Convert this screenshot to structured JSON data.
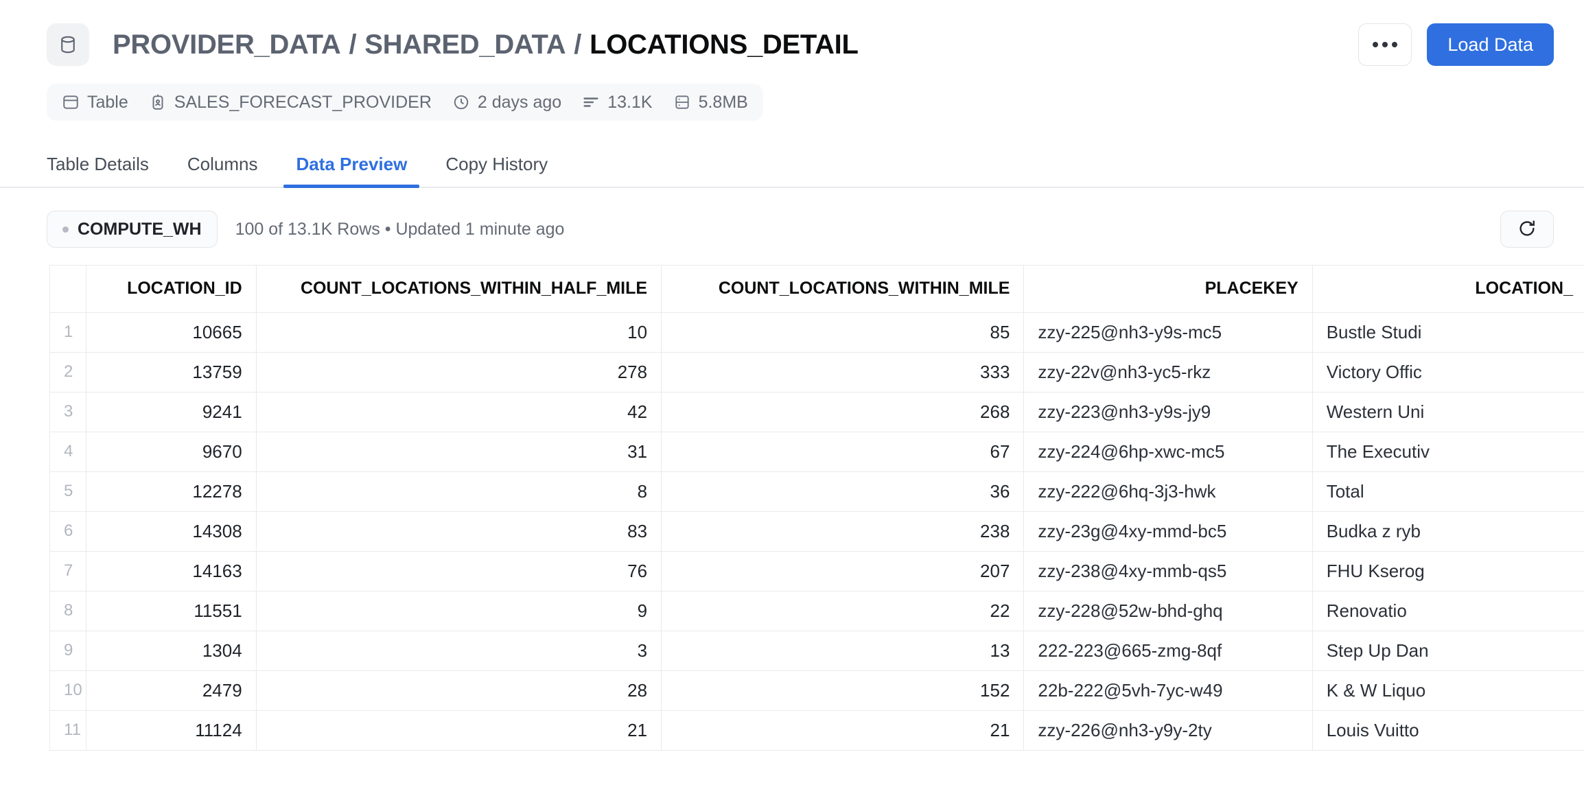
{
  "header": {
    "db_icon": "database-icon",
    "breadcrumb": {
      "parts": [
        "PROVIDER_DATA",
        "SHARED_DATA"
      ],
      "separator": "/",
      "current": "LOCATIONS_DETAIL"
    },
    "more_label": "",
    "load_data_label": "Load Data",
    "accent_color": "#2f6fe0"
  },
  "meta": [
    {
      "icon": "table-icon",
      "label": "Table"
    },
    {
      "icon": "provider-icon",
      "label": "SALES_FORECAST_PROVIDER"
    },
    {
      "icon": "clock-icon",
      "label": "2 days ago"
    },
    {
      "icon": "rows-icon",
      "label": "13.1K"
    },
    {
      "icon": "storage-icon",
      "label": "5.8MB"
    }
  ],
  "tabs": [
    {
      "label": "Table Details",
      "active": false
    },
    {
      "label": "Columns",
      "active": false
    },
    {
      "label": "Data Preview",
      "active": true
    },
    {
      "label": "Copy History",
      "active": false
    }
  ],
  "status": {
    "warehouse": "COMPUTE_WH",
    "warehouse_dot_color": "#b6bbc3",
    "summary": "100 of 13.1K Rows • Updated 1 minute ago",
    "refresh_icon": "refresh-icon"
  },
  "table": {
    "columns": [
      {
        "name": "LOCATION_ID",
        "align": "right"
      },
      {
        "name": "COUNT_LOCATIONS_WITHIN_HALF_MILE",
        "align": "right"
      },
      {
        "name": "COUNT_LOCATIONS_WITHIN_MILE",
        "align": "right"
      },
      {
        "name": "PLACEKEY",
        "align": "left"
      },
      {
        "name": "LOCATION_",
        "align": "left",
        "truncated": true
      }
    ],
    "rows": [
      {
        "n": "1",
        "location_id": "10665",
        "half_mile": "10",
        "mile": "85",
        "placekey": "zzy-225@nh3-y9s-mc5",
        "location_name": "Bustle Studi"
      },
      {
        "n": "2",
        "location_id": "13759",
        "half_mile": "278",
        "mile": "333",
        "placekey": "zzy-22v@nh3-yc5-rkz",
        "location_name": "Victory Offic"
      },
      {
        "n": "3",
        "location_id": "9241",
        "half_mile": "42",
        "mile": "268",
        "placekey": "zzy-223@nh3-y9s-jy9",
        "location_name": "Western Uni"
      },
      {
        "n": "4",
        "location_id": "9670",
        "half_mile": "31",
        "mile": "67",
        "placekey": "zzy-224@6hp-xwc-mc5",
        "location_name": "The Executiv"
      },
      {
        "n": "5",
        "location_id": "12278",
        "half_mile": "8",
        "mile": "36",
        "placekey": "zzy-222@6hq-3j3-hwk",
        "location_name": "Total"
      },
      {
        "n": "6",
        "location_id": "14308",
        "half_mile": "83",
        "mile": "238",
        "placekey": "zzy-23g@4xy-mmd-bc5",
        "location_name": "Budka z ryb"
      },
      {
        "n": "7",
        "location_id": "14163",
        "half_mile": "76",
        "mile": "207",
        "placekey": "zzy-238@4xy-mmb-qs5",
        "location_name": "FHU Kserog"
      },
      {
        "n": "8",
        "location_id": "11551",
        "half_mile": "9",
        "mile": "22",
        "placekey": "zzy-228@52w-bhd-ghq",
        "location_name": "Renovatio"
      },
      {
        "n": "9",
        "location_id": "1304",
        "half_mile": "3",
        "mile": "13",
        "placekey": "222-223@665-zmg-8qf",
        "location_name": "Step Up Dan"
      },
      {
        "n": "10",
        "location_id": "2479",
        "half_mile": "28",
        "mile": "152",
        "placekey": "22b-222@5vh-7yc-w49",
        "location_name": "K & W Liquo"
      },
      {
        "n": "11",
        "location_id": "11124",
        "half_mile": "21",
        "mile": "21",
        "placekey": "zzy-226@nh3-y9y-2ty",
        "location_name": "Louis Vuitto"
      }
    ]
  }
}
